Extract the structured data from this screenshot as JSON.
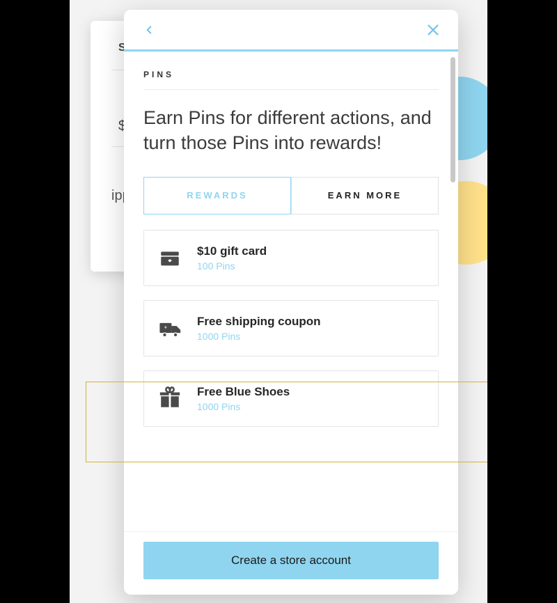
{
  "background": {
    "line1": "SCOU",
    "line2": "$",
    "line3": "ippi"
  },
  "modal": {
    "section_label": "PINS",
    "headline": "Earn Pins for different actions, and turn those Pins into rewards!",
    "tabs": {
      "rewards": "REWARDS",
      "earn_more": "EARN MORE"
    },
    "rewards": [
      {
        "icon": "gift-card-icon",
        "title": "$10 gift card",
        "cost": "100 Pins"
      },
      {
        "icon": "truck-icon",
        "title": "Free shipping coupon",
        "cost": "1000 Pins"
      },
      {
        "icon": "gift-icon",
        "title": "Free Blue Shoes",
        "cost": "1000 Pins"
      }
    ],
    "cta": "Create a store account"
  }
}
